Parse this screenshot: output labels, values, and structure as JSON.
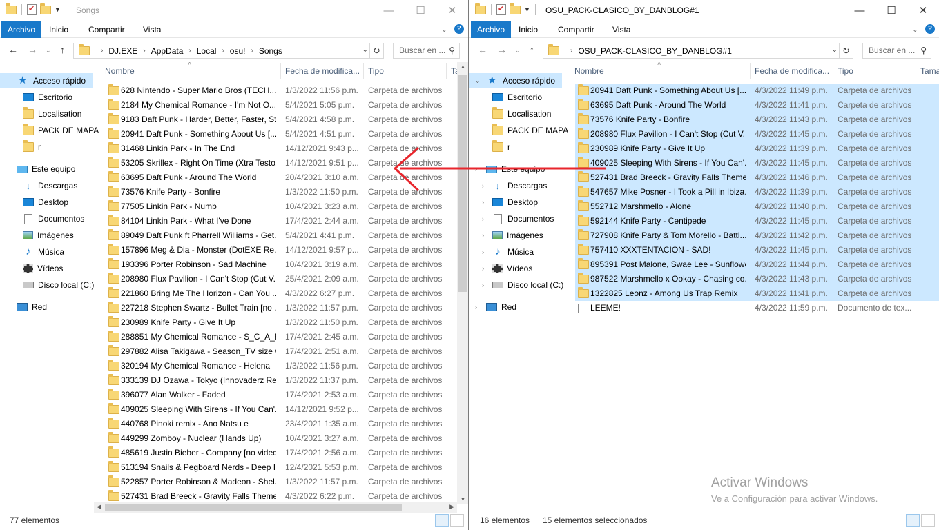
{
  "left": {
    "title": "Songs",
    "ribbon": {
      "file": "Archivo",
      "home": "Inicio",
      "share": "Compartir",
      "view": "Vista"
    },
    "path": [
      "DJ.EXE",
      "AppData",
      "Local",
      "osu!",
      "Songs"
    ],
    "search_placeholder": "Buscar en ...",
    "columns": {
      "name": "Nombre",
      "date": "Fecha de modifica...",
      "type": "Tipo",
      "size": "Ta"
    },
    "sidebar": [
      {
        "label": "Acceso rápido",
        "icon": "star-icon"
      },
      {
        "label": "Escritorio",
        "icon": "desktop-icon"
      },
      {
        "label": "Localisation",
        "icon": "folder-icon"
      },
      {
        "label": "PACK DE MAPA",
        "icon": "folder-icon"
      },
      {
        "label": "r",
        "icon": "folder-icon"
      },
      {
        "label": "Este equipo",
        "icon": "computer-icon"
      },
      {
        "label": "Descargas",
        "icon": "download-icon"
      },
      {
        "label": "Desktop",
        "icon": "desktop-icon"
      },
      {
        "label": "Documentos",
        "icon": "document-icon"
      },
      {
        "label": "Imágenes",
        "icon": "pictures-icon"
      },
      {
        "label": "Música",
        "icon": "music-icon"
      },
      {
        "label": "Vídeos",
        "icon": "video-icon"
      },
      {
        "label": "Disco local (C:)",
        "icon": "disk-icon"
      },
      {
        "label": "Red",
        "icon": "network-icon"
      }
    ],
    "files": [
      {
        "name": "628 Nintendo - Super Mario Bros (TECH...",
        "date": "1/3/2022 11:56 p.m.",
        "type": "Carpeta de archivos"
      },
      {
        "name": "2184 My Chemical Romance - I'm Not O...",
        "date": "5/4/2021 5:05 p.m.",
        "type": "Carpeta de archivos"
      },
      {
        "name": "9183 Daft Punk - Harder, Better, Faster, St...",
        "date": "5/4/2021 4:58 p.m.",
        "type": "Carpeta de archivos"
      },
      {
        "name": "20941 Daft Punk - Something About Us [...",
        "date": "5/4/2021 4:51 p.m.",
        "type": "Carpeta de archivos"
      },
      {
        "name": "31468 Linkin Park - In The End",
        "date": "14/12/2021 9:43 p...",
        "type": "Carpeta de archivos"
      },
      {
        "name": "53205 Skrillex - Right On Time (Xtra Testo...",
        "date": "14/12/2021 9:51 p...",
        "type": "Carpeta de archivos"
      },
      {
        "name": "63695 Daft Punk - Around The World",
        "date": "20/4/2021 3:10 a.m.",
        "type": "Carpeta de archivos"
      },
      {
        "name": "73576 Knife Party - Bonfire",
        "date": "1/3/2022 11:50 p.m.",
        "type": "Carpeta de archivos"
      },
      {
        "name": "77505 Linkin Park - Numb",
        "date": "10/4/2021 3:23 a.m.",
        "type": "Carpeta de archivos"
      },
      {
        "name": "84104 Linkin Park - What I've Done",
        "date": "17/4/2021 2:44 a.m.",
        "type": "Carpeta de archivos"
      },
      {
        "name": "89049 Daft Punk ft Pharrell Williams - Get...",
        "date": "5/4/2021 4:41 p.m.",
        "type": "Carpeta de archivos"
      },
      {
        "name": "157896 Meg & Dia - Monster (DotEXE Re...",
        "date": "14/12/2021 9:57 p...",
        "type": "Carpeta de archivos"
      },
      {
        "name": "193396 Porter Robinson - Sad Machine",
        "date": "10/4/2021 3:19 a.m.",
        "type": "Carpeta de archivos"
      },
      {
        "name": "208980 Flux Pavilion - I Can't Stop (Cut V...",
        "date": "25/4/2021 2:09 a.m.",
        "type": "Carpeta de archivos"
      },
      {
        "name": "221860 Bring Me The Horizon - Can You ...",
        "date": "4/3/2022 6:27 p.m.",
        "type": "Carpeta de archivos"
      },
      {
        "name": "227218 Stephen Swartz - Bullet Train [no ...",
        "date": "1/3/2022 11:57 p.m.",
        "type": "Carpeta de archivos"
      },
      {
        "name": "230989 Knife Party - Give It Up",
        "date": "1/3/2022 11:50 p.m.",
        "type": "Carpeta de archivos"
      },
      {
        "name": "288851 My Chemical Romance - S_C_A_R...",
        "date": "17/4/2021 2:45 a.m.",
        "type": "Carpeta de archivos"
      },
      {
        "name": "297882 Alisa Takigawa - Season_TV size v...",
        "date": "17/4/2021 2:51 a.m.",
        "type": "Carpeta de archivos"
      },
      {
        "name": "320194 My Chemical Romance - Helena",
        "date": "1/3/2022 11:56 p.m.",
        "type": "Carpeta de archivos"
      },
      {
        "name": "333139 DJ Ozawa - Tokyo (Innovaderz Re...",
        "date": "1/3/2022 11:37 p.m.",
        "type": "Carpeta de archivos"
      },
      {
        "name": "396077 Alan Walker - Faded",
        "date": "17/4/2021 2:53 a.m.",
        "type": "Carpeta de archivos"
      },
      {
        "name": "409025 Sleeping With Sirens - If You Can'...",
        "date": "14/12/2021 9:52 p...",
        "type": "Carpeta de archivos"
      },
      {
        "name": "440768 Pinoki remix - Ano Natsu e",
        "date": "23/4/2021 1:35 a.m.",
        "type": "Carpeta de archivos"
      },
      {
        "name": "449299 Zomboy - Nuclear (Hands Up)",
        "date": "10/4/2021 3:27 a.m.",
        "type": "Carpeta de archivos"
      },
      {
        "name": "485619 Justin Bieber - Company [no video]",
        "date": "17/4/2021 2:56 a.m.",
        "type": "Carpeta de archivos"
      },
      {
        "name": "513194 Snails & Pegboard Nerds - Deep I...",
        "date": "12/4/2021 5:53 p.m.",
        "type": "Carpeta de archivos"
      },
      {
        "name": "522857 Porter Robinson & Madeon - Shel...",
        "date": "1/3/2022 11:57 p.m.",
        "type": "Carpeta de archivos"
      },
      {
        "name": "527431 Brad Breeck - Gravity Falls Theme...",
        "date": "4/3/2022 6:22 p.m.",
        "type": "Carpeta de archivos"
      }
    ],
    "status": "77 elementos"
  },
  "right": {
    "title": "OSU_PACK-CLASICO_BY_DANBLOG#1",
    "ribbon": {
      "file": "Archivo",
      "home": "Inicio",
      "share": "Compartir",
      "view": "Vista"
    },
    "path": [
      "OSU_PACK-CLASICO_BY_DANBLOG#1"
    ],
    "search_placeholder": "Buscar en ...",
    "columns": {
      "name": "Nombre",
      "date": "Fecha de modifica...",
      "type": "Tipo",
      "size": "Tama"
    },
    "sidebar": [
      {
        "label": "Acceso rápido",
        "icon": "star-icon"
      },
      {
        "label": "Escritorio",
        "icon": "desktop-icon"
      },
      {
        "label": "Localisation",
        "icon": "folder-icon"
      },
      {
        "label": "PACK DE MAPA",
        "icon": "folder-icon"
      },
      {
        "label": "r",
        "icon": "folder-icon"
      },
      {
        "label": "Este equipo",
        "icon": "computer-icon"
      },
      {
        "label": "Descargas",
        "icon": "download-icon"
      },
      {
        "label": "Desktop",
        "icon": "desktop-icon"
      },
      {
        "label": "Documentos",
        "icon": "document-icon"
      },
      {
        "label": "Imágenes",
        "icon": "pictures-icon"
      },
      {
        "label": "Música",
        "icon": "music-icon"
      },
      {
        "label": "Vídeos",
        "icon": "video-icon"
      },
      {
        "label": "Disco local (C:)",
        "icon": "disk-icon"
      },
      {
        "label": "Red",
        "icon": "network-icon"
      }
    ],
    "files": [
      {
        "name": "20941 Daft Punk - Something About Us [...",
        "date": "4/3/2022 11:49 p.m.",
        "type": "Carpeta de archivos",
        "selected": true
      },
      {
        "name": "63695 Daft Punk - Around The World",
        "date": "4/3/2022 11:41 p.m.",
        "type": "Carpeta de archivos",
        "selected": true
      },
      {
        "name": "73576 Knife Party - Bonfire",
        "date": "4/3/2022 11:43 p.m.",
        "type": "Carpeta de archivos",
        "selected": true
      },
      {
        "name": "208980 Flux Pavilion - I Can't Stop (Cut V...",
        "date": "4/3/2022 11:45 p.m.",
        "type": "Carpeta de archivos",
        "selected": true
      },
      {
        "name": "230989 Knife Party - Give It Up",
        "date": "4/3/2022 11:39 p.m.",
        "type": "Carpeta de archivos",
        "selected": true
      },
      {
        "name": "409025 Sleeping With Sirens - If You Can'...",
        "date": "4/3/2022 11:45 p.m.",
        "type": "Carpeta de archivos",
        "selected": true
      },
      {
        "name": "527431 Brad Breeck - Gravity Falls Theme...",
        "date": "4/3/2022 11:46 p.m.",
        "type": "Carpeta de archivos",
        "selected": true
      },
      {
        "name": "547657 Mike Posner - I Took a Pill in Ibiza...",
        "date": "4/3/2022 11:39 p.m.",
        "type": "Carpeta de archivos",
        "selected": true
      },
      {
        "name": "552712 Marshmello - Alone",
        "date": "4/3/2022 11:40 p.m.",
        "type": "Carpeta de archivos",
        "selected": true
      },
      {
        "name": "592144 Knife Party - Centipede",
        "date": "4/3/2022 11:45 p.m.",
        "type": "Carpeta de archivos",
        "selected": true
      },
      {
        "name": "727908 Knife Party & Tom Morello - Battl...",
        "date": "4/3/2022 11:42 p.m.",
        "type": "Carpeta de archivos",
        "selected": true
      },
      {
        "name": "757410 XXXTENTACION - SAD!",
        "date": "4/3/2022 11:45 p.m.",
        "type": "Carpeta de archivos",
        "selected": true
      },
      {
        "name": "895391 Post Malone, Swae Lee - Sunflower",
        "date": "4/3/2022 11:44 p.m.",
        "type": "Carpeta de archivos",
        "selected": true
      },
      {
        "name": "987522 Marshmello x Ookay - Chasing co...",
        "date": "4/3/2022 11:43 p.m.",
        "type": "Carpeta de archivos",
        "selected": true
      },
      {
        "name": "1322825 Leonz - Among Us Trap Remix",
        "date": "4/3/2022 11:41 p.m.",
        "type": "Carpeta de archivos",
        "selected": true
      },
      {
        "name": "LEEME!",
        "date": "4/3/2022 11:59 p.m.",
        "type": "Documento de tex...",
        "selected": false,
        "is_text": true
      }
    ],
    "status": "16 elementos",
    "selection_status": "15 elementos seleccionados"
  },
  "watermark": {
    "line1": "Activar Windows",
    "line2": "Ve a Configuración para activar Windows."
  },
  "colors": {
    "accent": "#1979ca",
    "selection": "#cce8ff",
    "arrow": "#e8262d"
  }
}
